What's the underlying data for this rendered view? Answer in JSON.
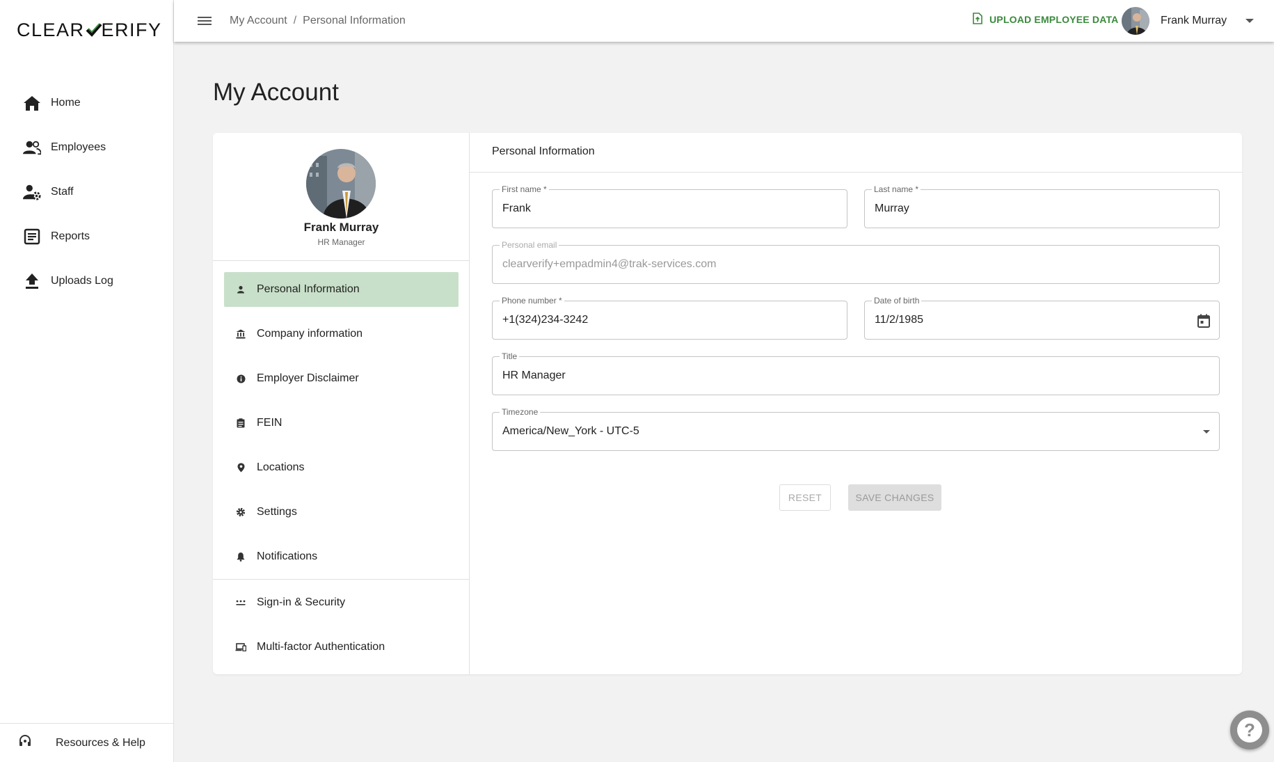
{
  "brand": {
    "logo_left": "CLEAR",
    "logo_right": "ERIFY",
    "accent": "#3a8a3c"
  },
  "sidebar": {
    "items": [
      {
        "label": "Home",
        "icon": "home-icon"
      },
      {
        "label": "Employees",
        "icon": "people-icon"
      },
      {
        "label": "Staff",
        "icon": "staff-gear-icon"
      },
      {
        "label": "Reports",
        "icon": "reports-icon"
      },
      {
        "label": "Uploads Log",
        "icon": "upload-icon"
      }
    ],
    "footer_label": "Resources & Help"
  },
  "topbar": {
    "breadcrumbs": [
      "My Account",
      "Personal Information"
    ],
    "separator": "/",
    "upload_label": "UPLOAD EMPLOYEE DATA",
    "user_name": "Frank Murray"
  },
  "page": {
    "title": "My Account"
  },
  "profile": {
    "name": "Frank Murray",
    "role": "HR Manager"
  },
  "account_menu": {
    "items": [
      {
        "label": "Personal Information",
        "icon": "person-icon",
        "active": true
      },
      {
        "label": "Company information",
        "icon": "bank-icon"
      },
      {
        "label": "Employer Disclaimer",
        "icon": "info-icon"
      },
      {
        "label": "FEIN",
        "icon": "clipboard-icon"
      },
      {
        "label": "Locations",
        "icon": "location-pin-icon"
      },
      {
        "label": "Settings",
        "icon": "gear-icon"
      },
      {
        "label": "Notifications",
        "icon": "bell-icon"
      }
    ],
    "security_items": [
      {
        "label": "Sign-in & Security",
        "icon": "password-dots-icon"
      },
      {
        "label": "Multi-factor Authentication",
        "icon": "devices-icon"
      }
    ]
  },
  "form": {
    "section_title": "Personal Information",
    "first_name": {
      "label": "First name *",
      "value": "Frank"
    },
    "last_name": {
      "label": "Last name *",
      "value": "Murray"
    },
    "personal_email": {
      "label": "Personal email",
      "value": "clearverify+empadmin4@trak-services.com"
    },
    "phone": {
      "label": "Phone number *",
      "value": "+1(324)234-3242"
    },
    "dob": {
      "label": "Date of birth",
      "value": "11/2/1985"
    },
    "title": {
      "label": "Title",
      "value": "HR Manager"
    },
    "timezone": {
      "label": "Timezone",
      "value": "America/New_York - UTC-5"
    },
    "reset_label": "RESET",
    "save_label": "SAVE CHANGES"
  },
  "help": {
    "label": "?"
  }
}
